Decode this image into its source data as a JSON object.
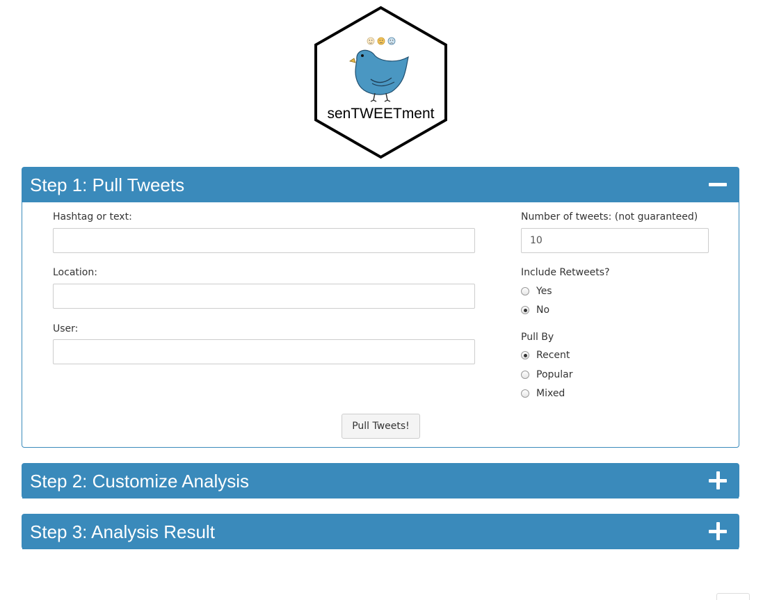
{
  "logo": {
    "text": "senTWEETment"
  },
  "steps": [
    {
      "title": "Step 1: Pull Tweets",
      "toggle": "collapse-icon"
    },
    {
      "title": "Step 2: Customize Analysis",
      "toggle": "expand-icon"
    },
    {
      "title": "Step 3: Analysis Result",
      "toggle": "expand-icon"
    }
  ],
  "step1": {
    "hashtag_label": "Hashtag or text:",
    "hashtag_value": "",
    "location_label": "Location:",
    "location_value": "",
    "user_label": "User:",
    "user_value": "",
    "num_label": "Number of tweets: (not guaranteed)",
    "num_value": "10",
    "retweets_label": "Include Retweets?",
    "retweets_options": [
      "Yes",
      "No"
    ],
    "retweets_selected": "No",
    "pullby_label": "Pull By",
    "pullby_options": [
      "Recent",
      "Popular",
      "Mixed"
    ],
    "pullby_selected": "Recent",
    "button_label": "Pull Tweets!"
  },
  "colors": {
    "accent": "#3a8abb",
    "bird": "#4a97c2"
  }
}
